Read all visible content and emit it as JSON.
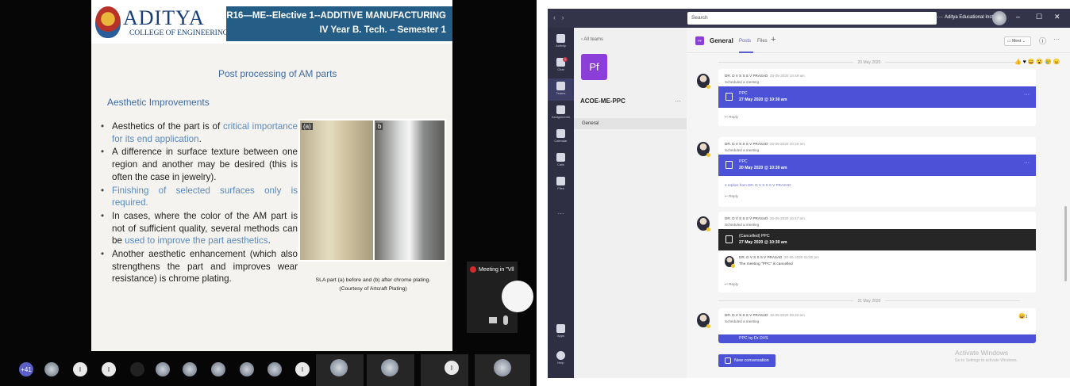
{
  "slide": {
    "logo_name": "ADITYA",
    "logo_sub": "COLLEGE OF ENGINEERING",
    "course_title": "R16—ME--Elective 1--ADDITIVE MANUFACTURING",
    "course_semester": "IV Year B. Tech. – Semester 1",
    "title": "Post processing of AM parts",
    "subtitle": "Aesthetic Improvements",
    "bullets": [
      {
        "before": "Aesthetics of the part is of ",
        "highlight": "critical importance for its end application",
        "after": "."
      },
      {
        "before": "A difference in surface texture between one region and another may be desired (this is often the case in jewelry).",
        "highlight": "",
        "after": ""
      },
      {
        "before": "",
        "highlight": "Finishing of selected surfaces only is required",
        "after": "."
      },
      {
        "before": "In cases, where the color of the AM part is not of sufficient quality, several methods can be ",
        "highlight": "used to improve the part aesthetics",
        "after": "."
      },
      {
        "before": "Another aesthetic enhancement (which also strengthens the part and improves wear resistance) is chrome plating.",
        "highlight": "",
        "after": ""
      }
    ],
    "photo_tag_a": "(a)",
    "photo_tag_b": "b",
    "caption_line1": "SLA part (a) before and (b) after chrome plating.",
    "caption_line2": "(Courtesy of Artcraft Plating)"
  },
  "pip": {
    "label": "Meeting in \"Vll"
  },
  "participants": {
    "more_count": "+41",
    "letters": [
      "I",
      "I",
      "I",
      "I"
    ]
  },
  "teams": {
    "search_placeholder": "Search",
    "top_more": "···",
    "org_name": "Aditya Educational Instit...",
    "rail": [
      {
        "label": "Activity"
      },
      {
        "label": "Chat",
        "badge": "1"
      },
      {
        "label": "Teams"
      },
      {
        "label": "Assignments"
      },
      {
        "label": "Calendar"
      },
      {
        "label": "Calls"
      },
      {
        "label": "Files"
      },
      {
        "label": "···"
      },
      {
        "label": "Apps"
      },
      {
        "label": "Help"
      }
    ],
    "all_teams": "All teams",
    "team_initials": "Pf",
    "team_name": "ACOE-ME-PPC",
    "channel": "General",
    "header": {
      "channel_icon": "PF",
      "channel_title": "General",
      "tab_posts": "Posts",
      "tab_files": "Files",
      "meet_label": "Meet",
      "meet_more": "⌄"
    },
    "dates": [
      "20 May 2020",
      "21 May 2020"
    ],
    "posts": [
      {
        "author": "DR. D V S S S V PRASAD",
        "time": "20-05-2020 10:49 am",
        "subtitle": "Scheduled a meeting",
        "card_title": "PPC",
        "card_when": "27 May 2020 @ 10:30 am",
        "reply": "Reply"
      },
      {
        "author": "DR. D V S S S V PRASAD",
        "time": "20-05-2020 10:29 am",
        "subtitle": "Scheduled a meeting",
        "card_title": "PPC",
        "card_when": "20 May 2020 @ 10:30 am",
        "replies_from": "4 replies from DR. D V S S S V PRASAD",
        "reply": "Reply"
      },
      {
        "author": "DR. D V S S S V PRASAD",
        "time": "20-05-2020 10:47 am",
        "subtitle": "Scheduled a meeting",
        "card_title": "(Cancelled) PPC",
        "card_when": "27 May 2020 @ 10:30 am",
        "nested_author": "DR. D V S S S V PRASAD",
        "nested_time": "20-05-2020 01:00 pm",
        "nested_text": "The meeting \"PPC\" is cancelled",
        "reply": "Reply"
      },
      {
        "author": "DR. D V S S S V PRASAD",
        "time": "13-05-2020 09:40 am",
        "subtitle": "Scheduled a meeting",
        "card_title": "PPC by Dr DVS",
        "reaction_count": "1"
      }
    ],
    "reactions_top": "👍 ♥ 😄 😮 😢 😠",
    "new_conversation": "New conversation",
    "activate_title": "Activate Windows",
    "activate_sub": "Go to Settings to activate Windows."
  }
}
